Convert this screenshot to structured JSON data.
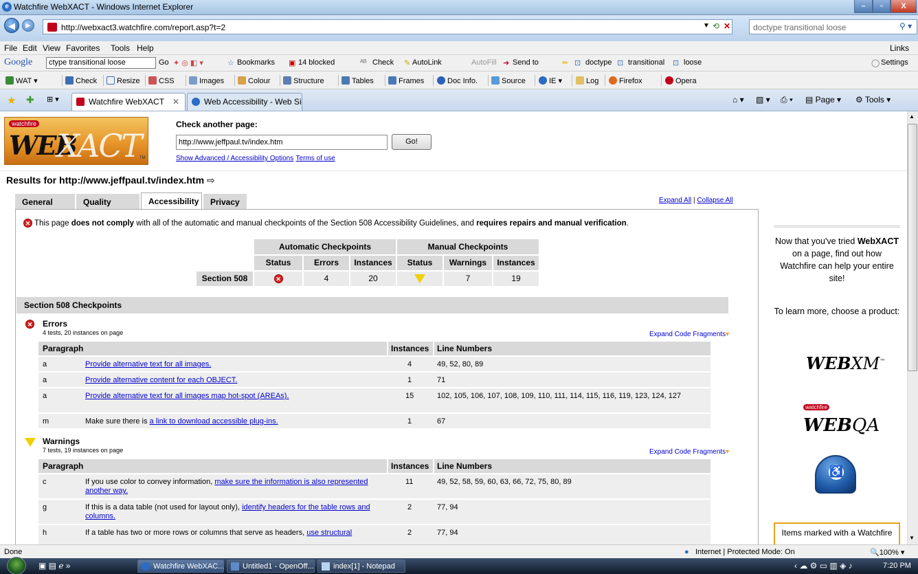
{
  "window": {
    "title": "Watchfire WebXACT - Windows Internet Explorer"
  },
  "address": {
    "url": "http://webxact3.watchfire.com/report.asp?t=2",
    "search_placeholder": "doctype transitional loose"
  },
  "menu": [
    "File",
    "Edit",
    "View",
    "Favorites",
    "Tools",
    "Help"
  ],
  "menu_links": "Links",
  "google_bar": {
    "logo": "Google",
    "query": "ctype transitional loose",
    "go": "Go",
    "bookmarks": "Bookmarks",
    "blocked": "14 blocked",
    "check": "Check",
    "autolink": "AutoLink",
    "autofill": "AutoFill",
    "sendto": "Send to",
    "term1": "doctype",
    "term2": "transitional",
    "term3": "loose",
    "settings": "Settings"
  },
  "wat_bar": [
    "WAT",
    "Check",
    "Resize",
    "CSS",
    "Images",
    "Colour",
    "Structure",
    "Tables",
    "Frames",
    "Doc Info.",
    "Source",
    "IE",
    "Log",
    "Firefox",
    "Opera"
  ],
  "tabs": [
    {
      "label": "Watchfire WebXACT"
    },
    {
      "label": "Web Accessibility - Web Si..."
    }
  ],
  "tab_tools": {
    "page": "Page",
    "tools": "Tools"
  },
  "page": {
    "logo_badge": "watchfire",
    "check_caption": "Check another page:",
    "check_url": "http://www.jeffpaul.tv/index.htm",
    "go_label": "Go!",
    "advanced_link": "Show Advanced / Accessibility Options",
    "terms_link": "Terms of use",
    "results_title": "Results for http://www.jeffpaul.tv/index.htm",
    "report_tabs": [
      "General",
      "Quality",
      "Accessibility",
      "Privacy"
    ],
    "expand_all": "Expand All",
    "collapse_all": "Collapse All",
    "compliance_pre": "This page ",
    "compliance_b1": "does not comply",
    "compliance_mid": " with all of the automatic and manual checkpoints of the Section 508 Accessibility Guidelines, and ",
    "compliance_b2": "requires repairs and manual verification",
    "compliance_end": ".",
    "summary": {
      "auto_header": "Automatic Checkpoints",
      "manual_header": "Manual Checkpoints",
      "col_status": "Status",
      "col_errors": "Errors",
      "col_instances": "Instances",
      "col_warnings": "Warnings",
      "row_label": "Section 508",
      "auto_errors": "4",
      "auto_instances": "20",
      "manual_warnings": "7",
      "manual_instances": "19"
    },
    "section_title": "Section 508 Checkpoints",
    "errors": {
      "title": "Errors",
      "subtitle": "4 tests, 20 instances on page",
      "expand": "Expand Code Fragments",
      "headers": [
        "Paragraph",
        "Instances",
        "Line Numbers"
      ],
      "rows": [
        {
          "para": "a",
          "pre": "",
          "link": "Provide alternative text for all images.",
          "post": "",
          "inst": "4",
          "lines": "49, 52, 80, 89"
        },
        {
          "para": "a",
          "pre": "",
          "link": "Provide alternative content for each OBJECT.",
          "post": "",
          "inst": "1",
          "lines": "71"
        },
        {
          "para": "a",
          "pre": "",
          "link": "Provide alternative text for all images map hot-spot (AREAs).",
          "post": "",
          "inst": "15",
          "lines": "102, 105, 106, 107, 108, 109, 110, 111, 114, 115, 116, 119, 123, 124, 127"
        },
        {
          "para": "m",
          "pre": "Make sure there is ",
          "link": "a link to download accessible plug-ins.",
          "post": "",
          "inst": "1",
          "lines": "67"
        }
      ]
    },
    "warnings": {
      "title": "Warnings",
      "subtitle": "7 tests, 19 instances on page",
      "expand": "Expand Code Fragments",
      "headers": [
        "Paragraph",
        "Instances",
        "Line Numbers"
      ],
      "rows": [
        {
          "para": "c",
          "pre": "If you use color to convey information, ",
          "link": "make sure the information is also represented another way.",
          "inst": "11",
          "lines": "49, 52, 58, 59, 60, 63, 66, 72, 75, 80, 89"
        },
        {
          "para": "g",
          "pre": "If this is a data table (not used for layout only), ",
          "link": "identify headers for the table rows and columns.",
          "inst": "2",
          "lines": "77, 94"
        },
        {
          "para": "h",
          "pre": "If a table has two or more rows or columns that serve as headers, ",
          "link": "use structural",
          "inst": "2",
          "lines": "77, 94"
        }
      ]
    },
    "promo": {
      "line1_pre": "Now that you've tried ",
      "line1_brand": "WebXACT",
      "line1_post": " on a page, find out how Watchfire can help your entire site!",
      "line2": "To learn more, choose a product:",
      "prod1": "WEBXM",
      "prod2": "WEBQA",
      "prod2_badge": "watchfire",
      "items_box": "Items marked with a Watchfire"
    }
  },
  "status": {
    "left": "Done",
    "zone": "Internet | Protected Mode: On",
    "zoom": "100%"
  },
  "taskbar": {
    "items": [
      "Watchfire WebXAC...",
      "Untitled1 - OpenOff...",
      "index[1] - Notepad"
    ],
    "clock": "7:20 PM"
  },
  "colors": {
    "accent_blue": "#0000cc",
    "error_red": "#d12424",
    "warning_yellow": "#f0d000",
    "promo_border": "#e8a21d"
  }
}
